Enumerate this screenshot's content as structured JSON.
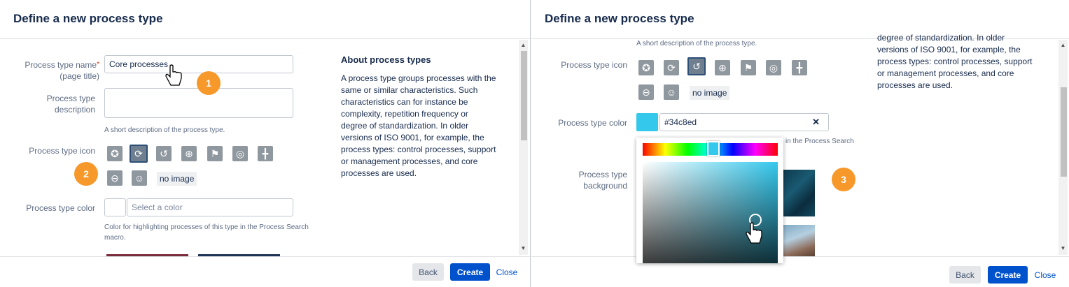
{
  "left": {
    "title": "Define a new process type",
    "name_label": "Process type name",
    "name_label_sub": "(page title)",
    "name_value": "Core processes",
    "desc_label_1": "Process type",
    "desc_label_2": "description",
    "desc_hint": "A short description of the process type.",
    "icon_label": "Process type icon",
    "no_image": "no image",
    "color_label": "Process type color",
    "color_placeholder": "Select a color",
    "color_hint_1": "Color for highlighting processes of this type in the Process Search",
    "color_hint_2": "macro.",
    "about_title": "About process types",
    "about_lines": [
      "A process type groups processes with the",
      "same or similar characteristics. Such",
      "characteristics can for instance be",
      "complexity, repetition frequency or",
      "degree of standardization. In older",
      "versions of ISO 9001, for example, the",
      "process types: control processes, support",
      "or management processes, and core",
      "processes are used."
    ],
    "back": "Back",
    "create": "Create",
    "close": "Close",
    "badge1": "1",
    "badge2": "2"
  },
  "right": {
    "title": "Define a new process type",
    "desc_hint": "A short description of the process type.",
    "icon_label": "Process type icon",
    "no_image": "no image",
    "color_label": "Process type color",
    "color_value": "#34c8ed",
    "clear_symbol": "✕",
    "hint_partial": "in the Process Search",
    "bg_label_1": "Process type",
    "bg_label_2": "background",
    "about_lines": [
      "degree of standardization. In older",
      "versions of ISO 9001, for example, the",
      "process types: control processes, support",
      "or management processes, and core",
      "processes are used."
    ],
    "back": "Back",
    "create": "Create",
    "close": "Close",
    "badge3": "3"
  },
  "colors": {
    "selected_color": "#34c8ed",
    "primary": "#0052cc",
    "badge": "#f7982a"
  },
  "icons": [
    "award-icon",
    "refresh-icon",
    "history-icon",
    "target-icon",
    "flag-icon",
    "lifebuoy-icon",
    "signpost-icon",
    "steering-wheel-icon",
    "user-icon"
  ]
}
